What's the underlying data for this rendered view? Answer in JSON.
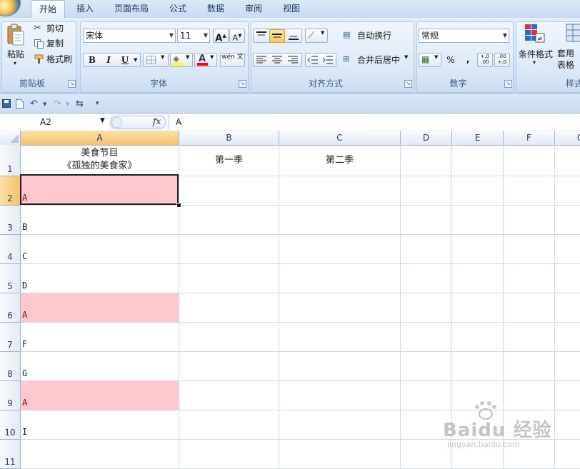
{
  "ribbon_tabs": [
    "开始",
    "插入",
    "页面布局",
    "公式",
    "数据",
    "审阅",
    "视图"
  ],
  "clipboard": {
    "paste": "粘贴",
    "cut": "剪切",
    "copy": "复制",
    "format_painter": "格式刷",
    "group": "剪贴板"
  },
  "font": {
    "name": "宋体",
    "size": "11",
    "bold": "B",
    "italic": "I",
    "underline": "U",
    "font_color_letter": "A",
    "phonetic": "wén 文",
    "group": "字体",
    "grow": "A",
    "shrink": "A"
  },
  "alignment": {
    "wrap": "自动换行",
    "merge": "合并后居中",
    "group": "对齐方式"
  },
  "number": {
    "format": "常规",
    "percent": "%",
    "comma": ",",
    "inc_decimal": "+.0 .00",
    "dec_decimal": ".00 +.0",
    "group": "数字"
  },
  "styles": {
    "conditional": "条件格式",
    "table_format": "套用表格格",
    "group": "样式"
  },
  "formula_bar": {
    "name_box": "A2",
    "fx": "fx",
    "content": "A"
  },
  "columns": [
    "A",
    "B",
    "C",
    "D",
    "E",
    "F",
    "G"
  ],
  "rows": [
    "1",
    "2",
    "3",
    "4",
    "5",
    "6",
    "7",
    "8",
    "9",
    "10",
    "11"
  ],
  "cells": {
    "a1_line1": "美食节目",
    "a1_line2": "《孤独的美食家》",
    "b1": "第一季",
    "c1": "第二季",
    "a2": "A",
    "a3": "B",
    "a4": "C",
    "a5": "D",
    "a6": "A",
    "a7": "F",
    "a8": "G",
    "a9": "A",
    "a10": "I"
  },
  "highlight_color": "#ffc7ce",
  "highlight_text_color": "#9c0006",
  "watermark": {
    "brand": "Bai",
    "brand2": "经验",
    "url": "jingyan.baidu.com"
  }
}
